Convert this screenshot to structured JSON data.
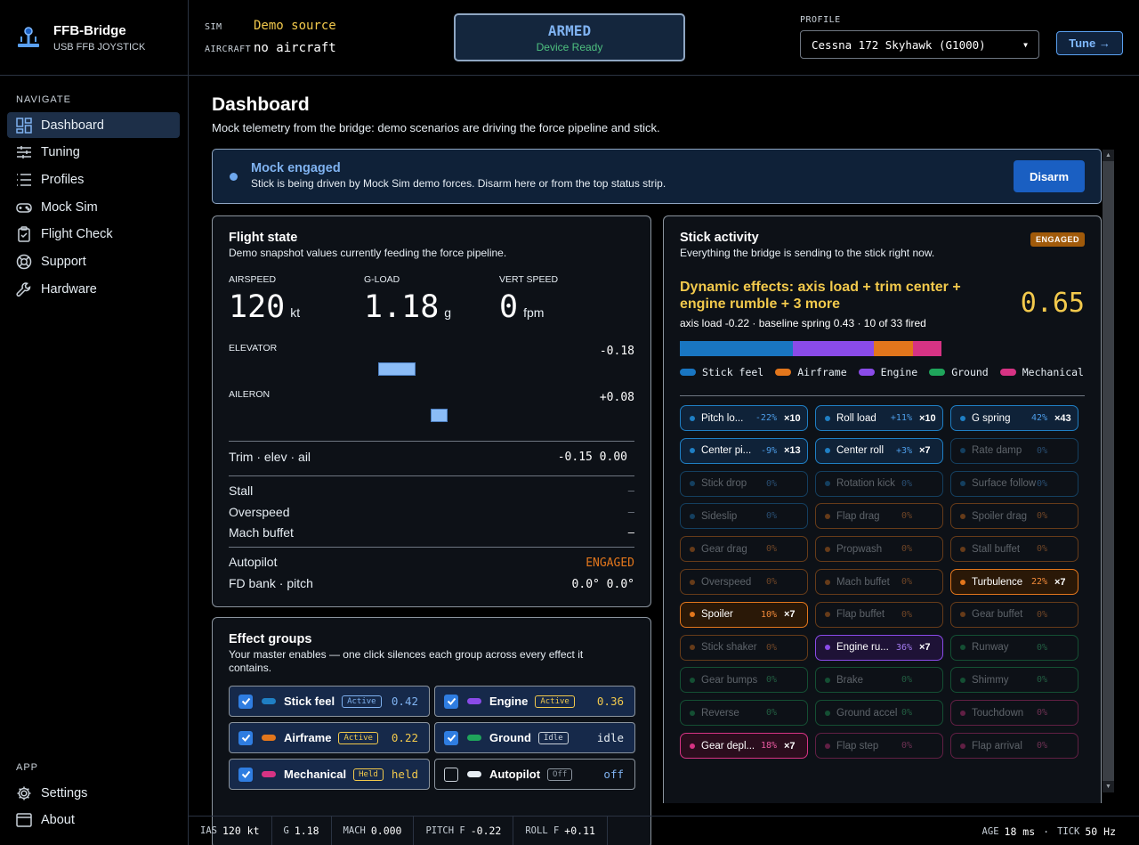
{
  "brand": {
    "title": "FFB-Bridge",
    "subtitle": "USB FFB JOYSTICK"
  },
  "nav": {
    "header": "NAVIGATE",
    "items": [
      {
        "label": "Dashboard",
        "icon": "dashboard-icon",
        "active": true
      },
      {
        "label": "Tuning",
        "icon": "sliders-icon"
      },
      {
        "label": "Profiles",
        "icon": "list-icon"
      },
      {
        "label": "Mock Sim",
        "icon": "gamepad-icon"
      },
      {
        "label": "Flight Check",
        "icon": "clipboard-check-icon"
      },
      {
        "label": "Support",
        "icon": "lifebuoy-icon"
      },
      {
        "label": "Hardware",
        "icon": "wrench-icon"
      }
    ],
    "app_header": "APP",
    "app_items": [
      {
        "label": "Settings",
        "icon": "gear-icon"
      },
      {
        "label": "About",
        "icon": "window-icon"
      }
    ]
  },
  "topbar": {
    "sim_key": "SIM",
    "sim_value": "Demo source",
    "aircraft_key": "AIRCRAFT",
    "aircraft_value": "no aircraft",
    "armed_title": "ARMED",
    "armed_sub": "Device Ready",
    "profile_label": "PROFILE",
    "profile_value": "Cessna 172 Skyhawk (G1000)",
    "tune_label": "Tune →"
  },
  "page": {
    "title": "Dashboard",
    "subtitle": "Mock telemetry from the bridge: demo scenarios are driving the force pipeline and stick."
  },
  "banner": {
    "title": "Mock engaged",
    "text": "Stick is being driven by Mock Sim demo forces. Disarm here or from the top status strip.",
    "button": "Disarm"
  },
  "flight": {
    "title": "Flight state",
    "subtitle": "Demo snapshot values currently feeding the force pipeline.",
    "metrics": [
      {
        "label": "AIRSPEED",
        "value": "120",
        "unit": "kt"
      },
      {
        "label": "G-LOAD",
        "value": "1.18",
        "unit": "g"
      },
      {
        "label": "VERT SPEED",
        "value": "0",
        "unit": "fpm"
      }
    ],
    "elevator_label": "ELEVATOR",
    "elevator_value": "-0.18",
    "elevator_level": -0.18,
    "aileron_label": "AILERON",
    "aileron_value": "+0.08",
    "aileron_level": 0.08,
    "trim_label": "Trim · elev · ail",
    "trim_value": "-0.15 0.00",
    "stall_label": "Stall",
    "stall_value": "–",
    "overspeed_label": "Overspeed",
    "overspeed_value": "–",
    "mach_label": "Mach buffet",
    "mach_value": "–",
    "autopilot_label": "Autopilot",
    "autopilot_value": "ENGAGED",
    "fd_label": "FD bank · pitch",
    "fd_value": "0.0° 0.0°"
  },
  "groups": {
    "title": "Effect groups",
    "subtitle": "Your master enables — one click silences each group across every effect it contains.",
    "items": [
      {
        "name": "Stick feel",
        "badge": "Active",
        "value": "0.42",
        "checked": true,
        "color": "#1f7fc4",
        "bcolor": "#7fb2f0"
      },
      {
        "name": "Engine",
        "badge": "Active",
        "value": "0.36",
        "checked": true,
        "color": "#8a4be8",
        "bcolor": "#f2c94c"
      },
      {
        "name": "Airframe",
        "badge": "Active",
        "value": "0.22",
        "checked": true,
        "color": "#e2761c",
        "bcolor": "#f2c94c"
      },
      {
        "name": "Ground",
        "badge": "Idle",
        "value": "idle",
        "checked": true,
        "color": "#1fa55b",
        "bcolor": "#c9d1d9"
      },
      {
        "name": "Mechanical",
        "badge": "Held",
        "value": "held",
        "checked": true,
        "color": "#d63384",
        "bcolor": "#f2c94c"
      },
      {
        "name": "Autopilot",
        "badge": "Off",
        "value": "off",
        "checked": false,
        "color": "#e6edf3",
        "bcolor": "#8b949e"
      }
    ]
  },
  "stick": {
    "title": "Stick activity",
    "subtitle": "Everything the bridge is sending to the stick right now.",
    "badge": "ENGAGED",
    "dyn_title": "Dynamic effects: axis load + trim center + engine rumble + 3 more",
    "dyn_sub": "axis load -0.22 · baseline spring 0.43 · 10 of 33 fired",
    "dyn_value": "0.65",
    "mix": [
      {
        "name": "Stick feel",
        "share": 0.43,
        "color": "#1976c2"
      },
      {
        "name": "Engine",
        "share": 0.31,
        "color": "#8a4be8"
      },
      {
        "name": "Airframe",
        "share": 0.15,
        "color": "#e2761c"
      },
      {
        "name": "Mechanical",
        "share": 0.11,
        "color": "#d63384"
      }
    ],
    "legend": [
      {
        "name": "Stick feel",
        "color": "#1976c2"
      },
      {
        "name": "Airframe",
        "color": "#e2761c"
      },
      {
        "name": "Engine",
        "color": "#8a4be8"
      },
      {
        "name": "Ground",
        "color": "#1fa55b"
      },
      {
        "name": "Mechanical",
        "color": "#d63384"
      }
    ],
    "chips": [
      {
        "name": "Pitch lo...",
        "pct": "-22%",
        "count": "×10",
        "group": "stick",
        "active": true
      },
      {
        "name": "Roll load",
        "pct": "+11%",
        "count": "×10",
        "group": "stick",
        "active": true
      },
      {
        "name": "G spring",
        "pct": "42%",
        "count": "×43",
        "group": "stick",
        "active": true
      },
      {
        "name": "Center pi...",
        "pct": "-9%",
        "count": "×13",
        "group": "stick",
        "active": true
      },
      {
        "name": "Center roll",
        "pct": "+3%",
        "count": "×7",
        "group": "stick",
        "active": true
      },
      {
        "name": "Rate damp",
        "pct": "0%",
        "count": "",
        "group": "stick",
        "active": false
      },
      {
        "name": "Stick drop",
        "pct": "0%",
        "count": "",
        "group": "stick",
        "active": false
      },
      {
        "name": "Rotation kick",
        "pct": "0%",
        "count": "",
        "group": "stick",
        "active": false
      },
      {
        "name": "Surface follow",
        "pct": "0%",
        "count": "",
        "group": "stick",
        "active": false
      },
      {
        "name": "Sideslip",
        "pct": "0%",
        "count": "",
        "group": "stick",
        "active": false
      },
      {
        "name": "Flap drag",
        "pct": "0%",
        "count": "",
        "group": "airframe",
        "active": false
      },
      {
        "name": "Spoiler drag",
        "pct": "0%",
        "count": "",
        "group": "airframe",
        "active": false
      },
      {
        "name": "Gear drag",
        "pct": "0%",
        "count": "",
        "group": "airframe",
        "active": false
      },
      {
        "name": "Propwash",
        "pct": "0%",
        "count": "",
        "group": "airframe",
        "active": false
      },
      {
        "name": "Stall buffet",
        "pct": "0%",
        "count": "",
        "group": "airframe",
        "active": false
      },
      {
        "name": "Overspeed",
        "pct": "0%",
        "count": "",
        "group": "airframe",
        "active": false
      },
      {
        "name": "Mach buffet",
        "pct": "0%",
        "count": "",
        "group": "airframe",
        "active": false
      },
      {
        "name": "Turbulence",
        "pct": "22%",
        "count": "×7",
        "group": "airframe",
        "active": true
      },
      {
        "name": "Spoiler",
        "pct": "10%",
        "count": "×7",
        "group": "airframe",
        "active": true
      },
      {
        "name": "Flap buffet",
        "pct": "0%",
        "count": "",
        "group": "airframe",
        "active": false
      },
      {
        "name": "Gear buffet",
        "pct": "0%",
        "count": "",
        "group": "airframe",
        "active": false
      },
      {
        "name": "Stick shaker",
        "pct": "0%",
        "count": "",
        "group": "airframe",
        "active": false
      },
      {
        "name": "Engine ru...",
        "pct": "36%",
        "count": "×7",
        "group": "engine",
        "active": true
      },
      {
        "name": "Runway",
        "pct": "0%",
        "count": "",
        "group": "ground",
        "active": false
      },
      {
        "name": "Gear bumps",
        "pct": "0%",
        "count": "",
        "group": "ground",
        "active": false
      },
      {
        "name": "Brake",
        "pct": "0%",
        "count": "",
        "group": "ground",
        "active": false
      },
      {
        "name": "Shimmy",
        "pct": "0%",
        "count": "",
        "group": "ground",
        "active": false
      },
      {
        "name": "Reverse",
        "pct": "0%",
        "count": "",
        "group": "ground",
        "active": false
      },
      {
        "name": "Ground accel",
        "pct": "0%",
        "count": "",
        "group": "ground",
        "active": false
      },
      {
        "name": "Touchdown",
        "pct": "0%",
        "count": "",
        "group": "mechanical",
        "active": false
      },
      {
        "name": "Gear depl...",
        "pct": "18%",
        "count": "×7",
        "group": "mechanical",
        "active": true
      },
      {
        "name": "Flap step",
        "pct": "0%",
        "count": "",
        "group": "mechanical",
        "active": false
      },
      {
        "name": "Flap arrival",
        "pct": "0%",
        "count": "",
        "group": "mechanical",
        "active": false
      }
    ]
  },
  "status": {
    "items": [
      {
        "key": "IAS",
        "value": "120 kt"
      },
      {
        "key": "G",
        "value": "1.18"
      },
      {
        "key": "MACH",
        "value": "0.000"
      },
      {
        "key": "PITCH F",
        "value": "-0.22"
      },
      {
        "key": "ROLL F",
        "value": "+0.11"
      }
    ],
    "age_key": "AGE",
    "age_value": "18 ms",
    "sep": "·",
    "tick_key": "TICK",
    "tick_value": "50 Hz"
  },
  "colors": {
    "accent": "#2f7de1",
    "armed": "#7fb2f0",
    "amber": "#f2c94c",
    "ok": "#4ec07f"
  }
}
